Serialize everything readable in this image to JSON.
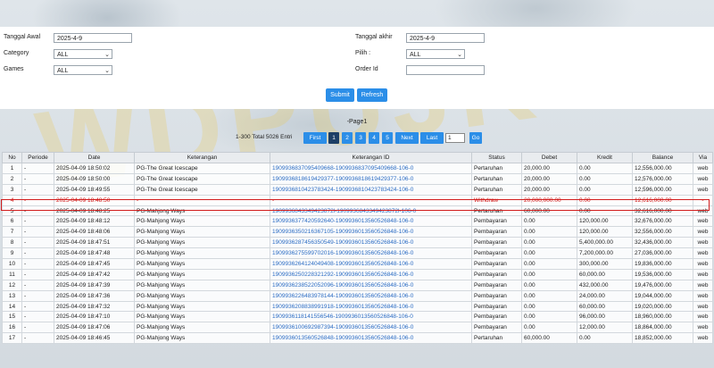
{
  "form": {
    "tanggal_awal_label": "Tanggal Awal",
    "tanggal_awal_value": "2025-4-9",
    "tanggal_akhir_label": "Tanggal akhir",
    "tanggal_akhir_value": "2025-4-9",
    "category_label": "Category",
    "category_value": "ALL",
    "pilih_label": "Pilih :",
    "pilih_value": "ALL",
    "games_label": "Games",
    "games_value": "ALL",
    "order_id_label": "Order Id",
    "order_id_value": "",
    "submit_label": "Submit",
    "refresh_label": "Refresh"
  },
  "pager": {
    "title": "-Page1",
    "info": "1-300 Total 5026 Entri",
    "first": "First",
    "pages": [
      "1",
      "2",
      "3",
      "4",
      "5"
    ],
    "next": "Next",
    "last": "Last",
    "page_input": "1",
    "go": "Go"
  },
  "table": {
    "headers": [
      "No",
      "Periode",
      "Date",
      "Keterangan",
      "Keterangan ID",
      "Status",
      "Debet",
      "Kredit",
      "Balance",
      "Via"
    ],
    "rows": [
      [
        "1",
        "-",
        "2025-04-09 18:50:02",
        "PG-The Great Icescape",
        "1909936837095409668-1909936837095409668-106-0",
        "Pertaruhan",
        "20,000.00",
        "0.00",
        "12,556,000.00",
        "web"
      ],
      [
        "2",
        "-",
        "2025-04-09 18:50:00",
        "PG-The Great Icescape",
        "1909936818619429377-1909936818619429377-106-0",
        "Pertaruhan",
        "20,000.00",
        "0.00",
        "12,576,000.00",
        "web"
      ],
      [
        "3",
        "-",
        "2025-04-09 18:49:55",
        "PG-The Great Icescape",
        "1909936810423783424-1909936810423783424-106-0",
        "Pertaruhan",
        "20,000.00",
        "0.00",
        "12,596,000.00",
        "web"
      ],
      [
        "4",
        "-",
        "2025-04-09 18:48:50",
        "-",
        "-",
        "Withdraw",
        "20,000,000.00",
        "0.00",
        "12,616,000.00",
        "-"
      ],
      [
        "5",
        "-",
        "2025-04-09 18:48:25",
        "PG-Mahjong Ways",
        "1909936843349423872l-1909936843349423872l-106-0",
        "Pertaruhan",
        "60,000.00",
        "0.00",
        "32,616,000.00",
        "web"
      ],
      [
        "6",
        "-",
        "2025-04-09 18:48:12",
        "PG-Mahjong Ways",
        "1909936377420592640-1909936013560526848-106-0",
        "Pembayaran",
        "0.00",
        "120,000.00",
        "32,676,000.00",
        "web"
      ],
      [
        "7",
        "-",
        "2025-04-09 18:48:06",
        "PG-Mahjong Ways",
        "1909936350216367105-1909936013560526848-106-0",
        "Pembayaran",
        "0.00",
        "120,000.00",
        "32,556,000.00",
        "web"
      ],
      [
        "8",
        "-",
        "2025-04-09 18:47:51",
        "PG-Mahjong Ways",
        "1909936287456350549-1909936013560526848-106-0",
        "Pembayaran",
        "0.00",
        "5,400,000.00",
        "32,436,000.00",
        "web"
      ],
      [
        "9",
        "-",
        "2025-04-09 18:47:48",
        "PG-Mahjong Ways",
        "1909936275599702016-1909936013560526848-106-0",
        "Pembayaran",
        "0.00",
        "7,200,000.00",
        "27,036,000.00",
        "web"
      ],
      [
        "10",
        "-",
        "2025-04-09 18:47:45",
        "PG-Mahjong Ways",
        "1909936264124049408-1909936013560526848-106-0",
        "Pembayaran",
        "0.00",
        "300,000.00",
        "19,836,000.00",
        "web"
      ],
      [
        "11",
        "-",
        "2025-04-09 18:47:42",
        "PG-Mahjong Ways",
        "1909936250228321292-1909936013560526848-106-0",
        "Pembayaran",
        "0.00",
        "60,000.00",
        "19,536,000.00",
        "web"
      ],
      [
        "12",
        "-",
        "2025-04-09 18:47:39",
        "PG-Mahjong Ways",
        "1909936238522052096-1909936013560526848-106-0",
        "Pembayaran",
        "0.00",
        "432,000.00",
        "19,476,000.00",
        "web"
      ],
      [
        "13",
        "-",
        "2025-04-09 18:47:36",
        "PG-Mahjong Ways",
        "1909936226483978144-1909936013560526848-106-0",
        "Pembayaran",
        "0.00",
        "24,000.00",
        "19,044,000.00",
        "web"
      ],
      [
        "14",
        "-",
        "2025-04-09 18:47:32",
        "PG-Mahjong Ways",
        "1909936208838991918-1909936013560526848-106-0",
        "Pembayaran",
        "0.00",
        "60,000.00",
        "19,020,000.00",
        "web"
      ],
      [
        "15",
        "-",
        "2025-04-09 18:47:10",
        "PG-Mahjong Ways",
        "1909936118141556546-1909936013560526848-106-0",
        "Pembayaran",
        "0.00",
        "96,000.00",
        "18,960,000.00",
        "web"
      ],
      [
        "16",
        "-",
        "2025-04-09 18:47:06",
        "PG-Mahjong Ways",
        "1909936100692987394-1909936013560526848-106-0",
        "Pembayaran",
        "0.00",
        "12,000.00",
        "18,864,000.00",
        "web"
      ],
      [
        "17",
        "-",
        "2025-04-09 18:46:45",
        "PG-Mahjong Ways",
        "1909936013560526848-1909936013560526848-106-0",
        "Pertaruhan",
        "60,000.00",
        "0.00",
        "18,852,000.00",
        "web"
      ]
    ]
  },
  "colors": {
    "accent": "#2b8ee8",
    "highlight_red": "#d01818"
  }
}
